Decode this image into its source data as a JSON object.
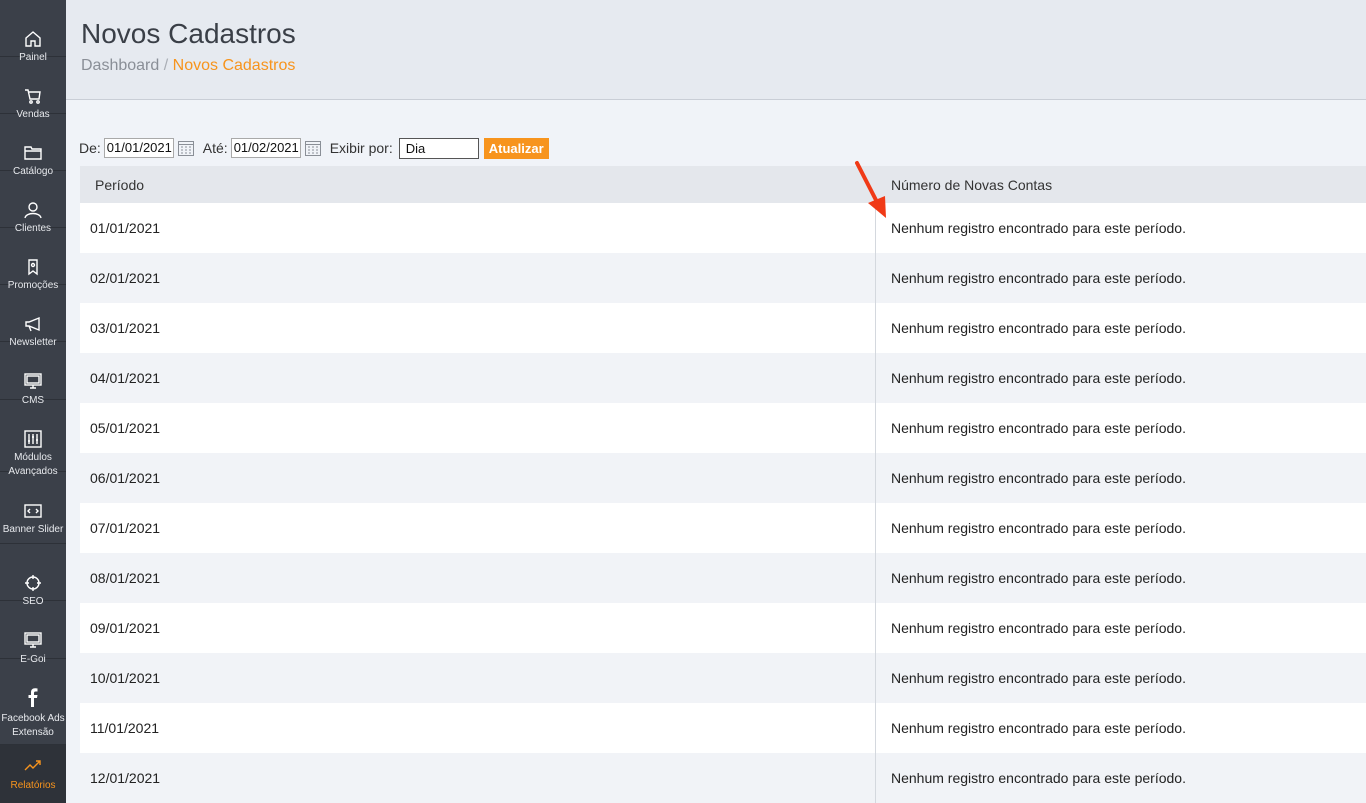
{
  "sidebar": {
    "items": [
      {
        "label": "Painel",
        "icon": "home-icon"
      },
      {
        "label": "Vendas",
        "icon": "cart-icon"
      },
      {
        "label": "Catálogo",
        "icon": "folder-icon"
      },
      {
        "label": "Clientes",
        "icon": "user-icon"
      },
      {
        "label": "Promoções",
        "icon": "tag-icon"
      },
      {
        "label": "Newsletter",
        "icon": "megaphone-icon"
      },
      {
        "label": "CMS",
        "icon": "monitor-icon"
      },
      {
        "label": "Módulos Avançados",
        "icon": "sliders-icon"
      },
      {
        "label": "Banner Slider",
        "icon": "code-icon"
      },
      {
        "label": "SEO",
        "icon": "crosshair-icon"
      },
      {
        "label": "E-Goi",
        "icon": "monitor-icon"
      },
      {
        "label": "Facebook Ads Extensão",
        "icon": "facebook-icon"
      },
      {
        "label": "Relatórios",
        "icon": "trend-icon"
      }
    ],
    "active": "Relatórios",
    "accent": "#f7941d"
  },
  "header": {
    "title": "Novos Cadastros",
    "breadcrumb": {
      "parent": "Dashboard",
      "separator": "/",
      "current": "Novos Cadastros"
    }
  },
  "filter": {
    "from_label": "De:",
    "from_value": "01/01/2021",
    "to_label": "Até:",
    "to_value": "01/02/2021",
    "group_label": "Exibir por:",
    "group_value": "Dia",
    "update_label": "Atualizar"
  },
  "table": {
    "headers": [
      "Período",
      "Número de Novas Contas"
    ],
    "rows": [
      {
        "period": "01/01/2021",
        "value": "Nenhum registro encontrado para este período."
      },
      {
        "period": "02/01/2021",
        "value": "Nenhum registro encontrado para este período."
      },
      {
        "period": "03/01/2021",
        "value": "Nenhum registro encontrado para este período."
      },
      {
        "period": "04/01/2021",
        "value": "Nenhum registro encontrado para este período."
      },
      {
        "period": "05/01/2021",
        "value": "Nenhum registro encontrado para este período."
      },
      {
        "period": "06/01/2021",
        "value": "Nenhum registro encontrado para este período."
      },
      {
        "period": "07/01/2021",
        "value": "Nenhum registro encontrado para este período."
      },
      {
        "period": "08/01/2021",
        "value": "Nenhum registro encontrado para este período."
      },
      {
        "period": "09/01/2021",
        "value": "Nenhum registro encontrado para este período."
      },
      {
        "period": "10/01/2021",
        "value": "Nenhum registro encontrado para este período."
      },
      {
        "period": "11/01/2021",
        "value": "Nenhum registro encontrado para este período."
      },
      {
        "period": "12/01/2021",
        "value": "Nenhum registro encontrado para este período."
      }
    ]
  },
  "annotation": {
    "color": "#f03a17"
  }
}
